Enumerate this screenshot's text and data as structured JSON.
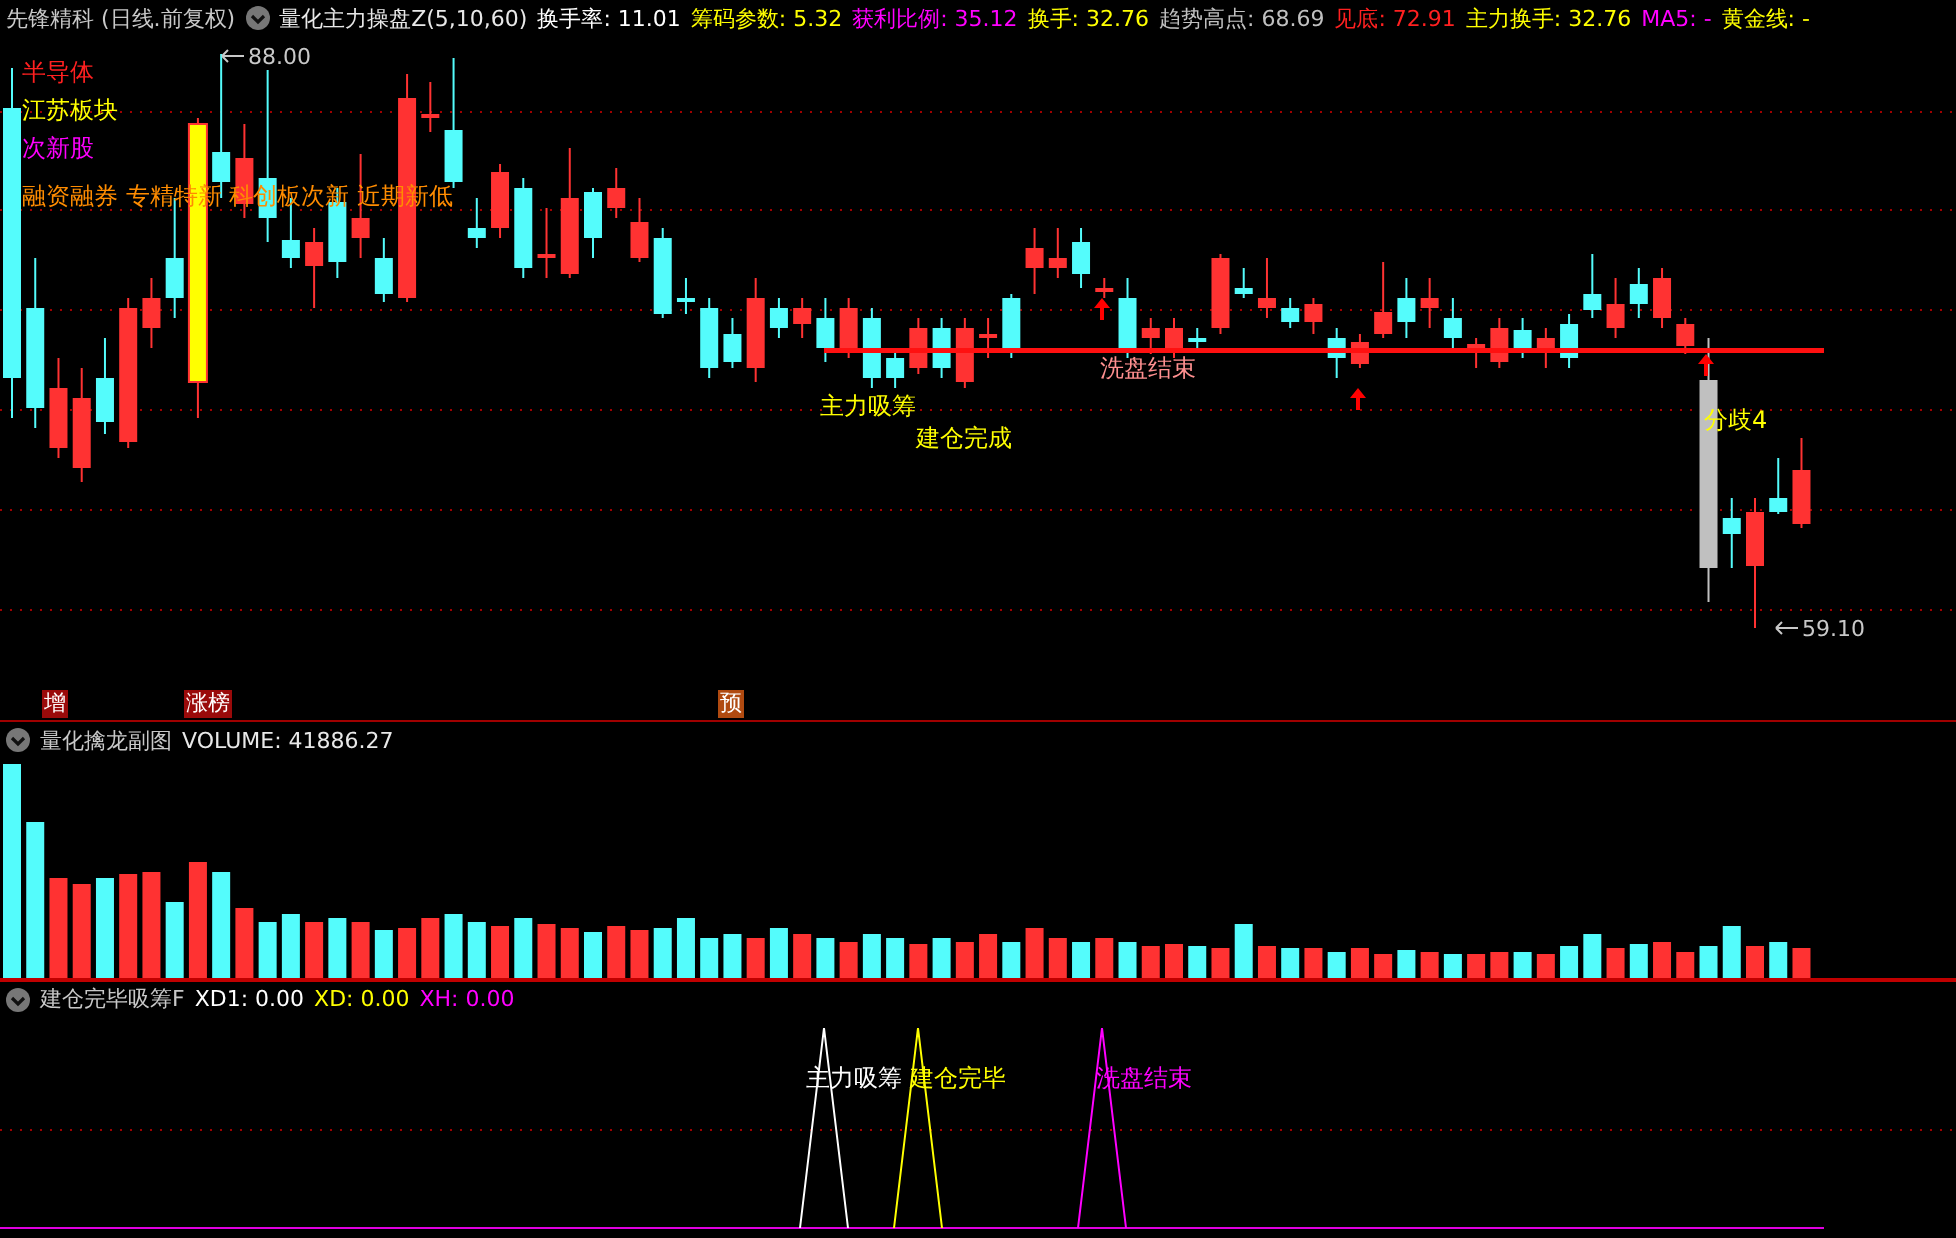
{
  "header": {
    "title": "先锋精科 (日线.前复权)",
    "indicator": "量化主力操盘Z(5,10,60)",
    "readouts": [
      {
        "label": "换手率:",
        "value": "11.01",
        "color": "#ffffff"
      },
      {
        "label": "筹码参数:",
        "value": "5.32",
        "color": "#ffff00"
      },
      {
        "label": "获利比例:",
        "value": "35.12",
        "color": "#ff00ff"
      },
      {
        "label": "换手:",
        "value": "32.76",
        "color": "#ffff00"
      },
      {
        "label": "趋势高点:",
        "value": "68.69",
        "color": "#c0c0c0"
      },
      {
        "label": "见底:",
        "value": "72.91",
        "color": "#ff2020"
      },
      {
        "label": "主力换手:",
        "value": "32.76",
        "color": "#ffff00"
      },
      {
        "label": "MA5:",
        "value": "-",
        "color": "#ff00ff"
      },
      {
        "label": "黄金线:",
        "value": "-",
        "color": "#ffff00"
      }
    ]
  },
  "main_chart": {
    "tags": [
      {
        "text": "半导体",
        "color": "#ff2020"
      },
      {
        "text": "江苏板块",
        "color": "#ffff00"
      },
      {
        "text": "次新股",
        "color": "#ff00ff"
      },
      {
        "text": "融资融券 专精特新 科创板次新 近期新低",
        "color": "#ff8c00"
      }
    ],
    "price_marks": [
      {
        "text": "88.00"
      },
      {
        "text": "59.10"
      }
    ],
    "signals": [
      {
        "text": "主力吸筹",
        "color": "#ffff00"
      },
      {
        "text": "建仓完成",
        "color": "#ffff00"
      },
      {
        "text": "洗盘结束",
        "color": "#ff9090"
      },
      {
        "text": "分歧4",
        "color": "#ffff00"
      }
    ],
    "markers": [
      {
        "text": "增",
        "color": "#9a0a0a"
      },
      {
        "text": "涨榜",
        "color": "#9a0a0a"
      },
      {
        "text": "预",
        "color": "#b04a10"
      }
    ]
  },
  "volume_panel": {
    "title": "量化擒龙副图",
    "reading": "VOLUME: 41886.27"
  },
  "signal_panel": {
    "title": "建仓完毕吸筹F",
    "readouts": [
      {
        "text": "XD1: 0.00",
        "color": "#ffffff"
      },
      {
        "text": "XD: 0.00",
        "color": "#ffff00"
      },
      {
        "text": "XH: 0.00",
        "color": "#ff00ff"
      }
    ],
    "labels": [
      {
        "text": "主力吸筹",
        "color": "#ffffff"
      },
      {
        "text": "建仓完毕",
        "color": "#ffff00"
      },
      {
        "text": "洗盘结束",
        "color": "#ff00ff"
      }
    ]
  }
}
